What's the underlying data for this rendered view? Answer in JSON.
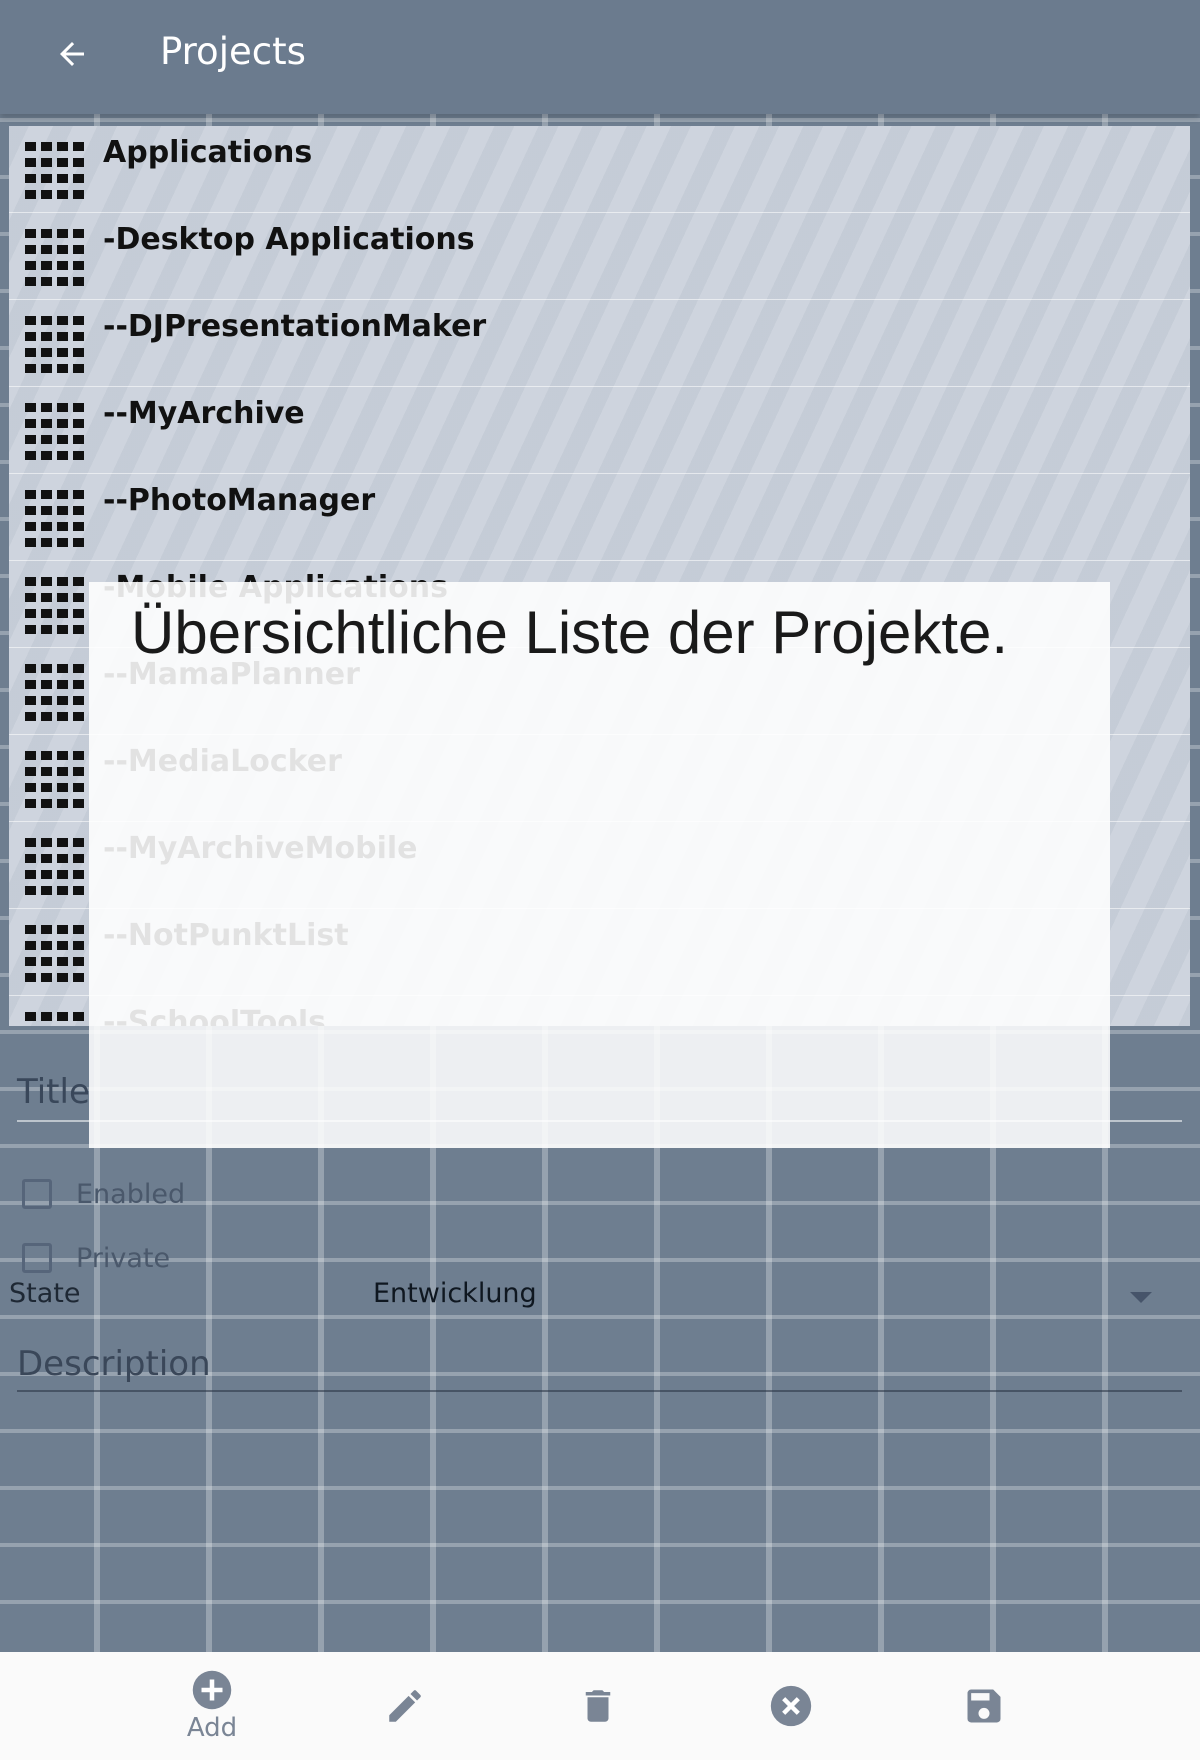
{
  "appbar": {
    "title": "Projects",
    "back_icon": "arrow-back-icon"
  },
  "projects": [
    "Applications",
    "-Desktop Applications",
    "--DJPresentationMaker",
    "--MyArchive",
    "--PhotoManager",
    "-Mobile Applications",
    "--MamaPlanner",
    "--MediaLocker",
    "--MyArchiveMobile",
    "--NotPunktList",
    "--SchoolTools"
  ],
  "form": {
    "title_label": "Title",
    "enabled_label": "Enabled",
    "private_label": "Private",
    "state_label": "State",
    "state_value": "Entwicklung",
    "description_label": "Description"
  },
  "overlay": {
    "text": "Übersichtliche Liste der Projekte."
  },
  "bottombar": {
    "add_label": "Add"
  },
  "colors": {
    "appbar": "#6b7b8e",
    "icon_gray": "#7a8595",
    "background": "#6e7e90"
  }
}
